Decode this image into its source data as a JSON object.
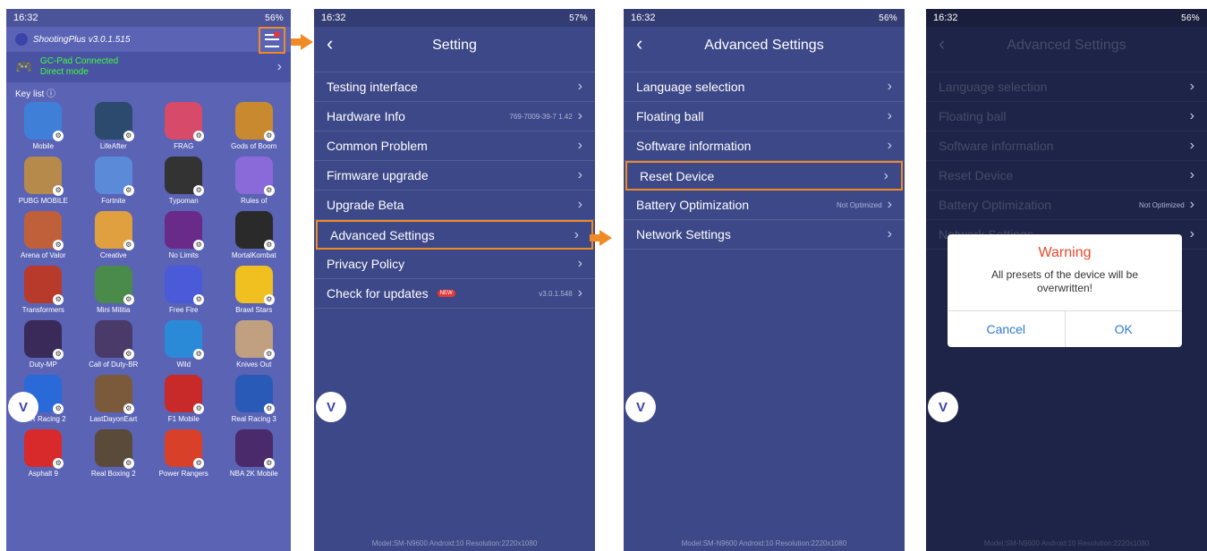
{
  "colors": {
    "highlight": "#f08a24",
    "accent_green": "#3cff3c",
    "warning_red": "#e84a2f",
    "dialog_button": "#2f7ad6"
  },
  "screen1": {
    "status": {
      "time": "16:32",
      "right": "56%"
    },
    "app_title": "ShootingPlus v3.0.1.515",
    "gc_status": "GC-Pad Connected",
    "gc_mode": "Direct mode",
    "keylist_label": "Key list ⓘ",
    "games": [
      {
        "name": "Mobile",
        "color": "#3f7fd8"
      },
      {
        "name": "LifeAfter",
        "color": "#2b4a6e"
      },
      {
        "name": "FRAG",
        "color": "#d84a6a"
      },
      {
        "name": "Gods of Boom",
        "color": "#c98a2f"
      },
      {
        "name": "PUBG MOBILE",
        "color": "#b58a4a"
      },
      {
        "name": "Fortnite",
        "color": "#5a8ad8"
      },
      {
        "name": "Typoman",
        "color": "#333333"
      },
      {
        "name": "Rules of",
        "color": "#8a6ad8"
      },
      {
        "name": "Arena of Valor",
        "color": "#c0603a"
      },
      {
        "name": "Creative",
        "color": "#e0a040"
      },
      {
        "name": "No Limits",
        "color": "#6a2a8a"
      },
      {
        "name": "MortalKombat",
        "color": "#2a2a2a"
      },
      {
        "name": "Transformers",
        "color": "#b83a2a"
      },
      {
        "name": "Mini Militia",
        "color": "#4a8a4a"
      },
      {
        "name": "Free Fire",
        "color": "#4a5ad8"
      },
      {
        "name": "Brawl Stars",
        "color": "#f0c020"
      },
      {
        "name": "Duty-MP",
        "color": "#3a2a5a"
      },
      {
        "name": "Call of Duty-BR",
        "color": "#4a3a6a"
      },
      {
        "name": "Wild",
        "color": "#2a8ad8"
      },
      {
        "name": "Knives Out",
        "color": "#c0a080"
      },
      {
        "name": "CSR Racing 2",
        "color": "#2a6ad8"
      },
      {
        "name": "LastDayonEart",
        "color": "#7a5a3a"
      },
      {
        "name": "F1 Mobile",
        "color": "#c82a2a"
      },
      {
        "name": "Real Racing 3",
        "color": "#2a5ab8"
      },
      {
        "name": "Asphalt 9",
        "color": "#d82a2a"
      },
      {
        "name": "Real Boxing 2",
        "color": "#5a4a3a"
      },
      {
        "name": "Power Rangers",
        "color": "#d8402a"
      },
      {
        "name": "NBA 2K Mobile",
        "color": "#4a2a6a"
      }
    ]
  },
  "screen2": {
    "status": {
      "time": "16:32",
      "right": "57%"
    },
    "title": "Setting",
    "items": [
      {
        "label": "Testing interface",
        "value": ""
      },
      {
        "label": "Hardware Info",
        "value": "769-7009-39-7  1.42"
      },
      {
        "label": "Common Problem",
        "value": ""
      },
      {
        "label": "Firmware upgrade",
        "value": ""
      },
      {
        "label": "Upgrade Beta",
        "value": ""
      },
      {
        "label": "Advanced Settings",
        "value": ""
      },
      {
        "label": "Privacy Policy",
        "value": ""
      },
      {
        "label": "Check for updates",
        "value": "v3.0.1.548",
        "badge": "NEW"
      }
    ],
    "footer": "Model:SM-N9600   Android:10   Resolution:2220x1080"
  },
  "screen3": {
    "status": {
      "time": "16:32",
      "right": "56%"
    },
    "title": "Advanced Settings",
    "items": [
      {
        "label": "Language selection",
        "value": ""
      },
      {
        "label": "Floating ball",
        "value": ""
      },
      {
        "label": "Software information",
        "value": ""
      },
      {
        "label": "Reset Device",
        "value": ""
      },
      {
        "label": "Battery Optimization",
        "value": "Not Optimized"
      },
      {
        "label": "Network Settings",
        "value": ""
      }
    ],
    "footer": "Model:SM-N9600   Android:10   Resolution:2220x1080"
  },
  "screen4": {
    "status": {
      "time": "16:32",
      "right": "56%"
    },
    "title": "Advanced Settings",
    "items": [
      {
        "label": "Language selection",
        "value": ""
      },
      {
        "label": "Floating ball",
        "value": ""
      },
      {
        "label": "Software information",
        "value": ""
      },
      {
        "label": "Reset Device",
        "value": ""
      },
      {
        "label": "Battery Optimization",
        "value": "Not Optimized"
      },
      {
        "label": "Network Settings",
        "value": ""
      }
    ],
    "dialog": {
      "title": "Warning",
      "message": "All presets of the device will be overwritten!",
      "cancel": "Cancel",
      "ok": "OK"
    },
    "footer": "Model:SM-N9600   Android:10   Resolution:2220x1080"
  },
  "floating_ball_label": "V"
}
